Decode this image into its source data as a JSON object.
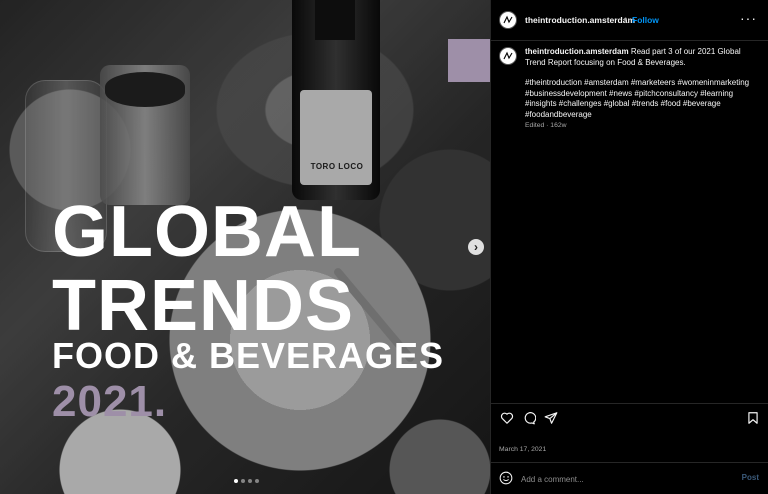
{
  "colors": {
    "accent_purple": "#9e8fa8",
    "link_blue": "#0095f6",
    "muted_text": "#a8a8a8",
    "divider": "#262626"
  },
  "media": {
    "headline": {
      "line1": "GLOBAL",
      "line2": "TRENDS",
      "line3": "FOOD & BEVERAGES",
      "line4": "2021."
    },
    "bottle_label": "TORO LOCO",
    "next_icon": "chevron-right-icon",
    "carousel": {
      "total": 4,
      "active": 1
    }
  },
  "header": {
    "username": "theintroduction.amsterdam",
    "separator": "•",
    "follow_label": "Follow",
    "more_label": "···"
  },
  "caption": {
    "username": "theintroduction.amsterdam",
    "text": "Read part 3 of our 2021 Global Trend Report focusing on Food & Beverages.",
    "hashtags": "#theintroduction #amsterdam #marketeers #womeninmarketing #businessdevelopment #news #pitchconsultancy #learning #insights #challenges #global #trends #food #beverage #foodandbeverage",
    "meta": "Edited · 162w"
  },
  "actions": {
    "like_icon": "heart-icon",
    "comment_icon": "comment-icon",
    "share_icon": "share-icon",
    "save_icon": "bookmark-icon"
  },
  "post_date": "March 17, 2021",
  "comment": {
    "emoji_icon": "emoji-icon",
    "placeholder": "Add a comment...",
    "post_label": "Post"
  }
}
